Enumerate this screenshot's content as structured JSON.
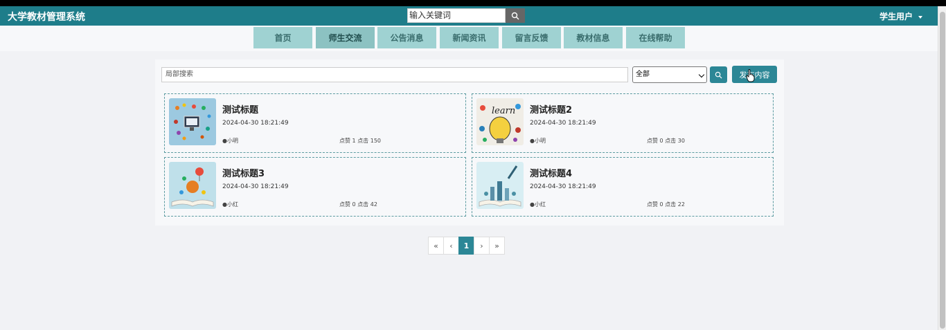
{
  "header": {
    "site_title": "大学教材管理系统",
    "search_placeholder": "输入关键词",
    "user_label": "学生用户"
  },
  "nav": {
    "items": [
      {
        "label": "首页"
      },
      {
        "label": "师生交流"
      },
      {
        "label": "公告消息"
      },
      {
        "label": "新闻资讯"
      },
      {
        "label": "留言反馈"
      },
      {
        "label": "教材信息"
      },
      {
        "label": "在线帮助"
      }
    ],
    "active_index": 1
  },
  "filter": {
    "search_placeholder": "局部搜索",
    "select_value": "全部",
    "publish_label": "发布内容"
  },
  "posts": [
    {
      "title": "测试标题",
      "date": "2024-04-30 18:21:49",
      "author": "小明",
      "likes_label": "点赞",
      "likes": "1",
      "clicks_label": "点击",
      "clicks": "150"
    },
    {
      "title": "测试标题2",
      "date": "2024-04-30 18:21:49",
      "author": "小明",
      "likes_label": "点赞",
      "likes": "0",
      "clicks_label": "点击",
      "clicks": "30"
    },
    {
      "title": "测试标题3",
      "date": "2024-04-30 18:21:49",
      "author": "小红",
      "likes_label": "点赞",
      "likes": "0",
      "clicks_label": "点击",
      "clicks": "42"
    },
    {
      "title": "测试标题4",
      "date": "2024-04-30 18:21:49",
      "author": "小红",
      "likes_label": "点赞",
      "likes": "0",
      "clicks_label": "点击",
      "clicks": "22"
    }
  ],
  "pagination": {
    "first": "«",
    "prev": "‹",
    "current": "1",
    "next": "›",
    "last": "»"
  },
  "colors": {
    "header": "#1e7d8a",
    "nav_item": "#9fd2d2",
    "accent": "#2c8796"
  }
}
